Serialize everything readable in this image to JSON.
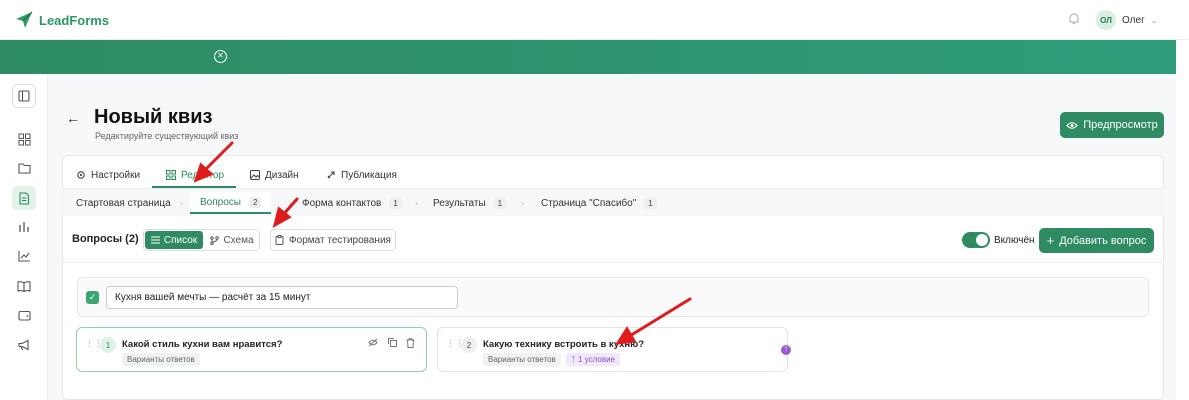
{
  "app": {
    "logo_text": "LeadForms",
    "brand_color": "#2e8b62"
  },
  "user": {
    "initials": "ОЛ",
    "name": "Олег"
  },
  "banner": {
    "close_icon": "close-circle-icon"
  },
  "sidebar": {
    "items": [
      {
        "icon": "sidebar-toggle-icon",
        "active": false
      },
      {
        "icon": "dashboard-grid-icon",
        "active": false
      },
      {
        "icon": "folder-icon",
        "active": false
      },
      {
        "icon": "document-icon",
        "active": true
      },
      {
        "icon": "bar-chart-icon",
        "active": false
      },
      {
        "icon": "line-chart-icon",
        "active": false
      },
      {
        "icon": "book-icon",
        "active": false
      },
      {
        "icon": "wallet-icon",
        "active": false
      },
      {
        "icon": "megaphone-icon",
        "active": false
      }
    ]
  },
  "page": {
    "title": "Новый квиз",
    "subtitle": "Редактируйте существующий квиз",
    "preview_label": "Предпросмотр"
  },
  "tabs": [
    {
      "label": "Настройки",
      "icon": "gear-icon"
    },
    {
      "label": "Редактор",
      "icon": "grid-icon",
      "active": true
    },
    {
      "label": "Дизайн",
      "icon": "image-icon"
    },
    {
      "label": "Публикация",
      "icon": "rocket-icon"
    }
  ],
  "subtabs": [
    {
      "label": "Стартовая страница"
    },
    {
      "label": "Вопросы",
      "count": "2",
      "active": true
    },
    {
      "label": "Форма контактов",
      "count": "1"
    },
    {
      "label": "Результаты",
      "count": "1"
    },
    {
      "label": "Страница \"Спасибо\"",
      "count": "1"
    }
  ],
  "toolbar": {
    "heading": "Вопросы (2)",
    "list_label": "Список",
    "scheme_label": "Схема",
    "format_label": "Формат тестирования",
    "enabled_label": "Включён",
    "enabled": true,
    "add_label": "Добавить вопрос"
  },
  "quiz_title": {
    "checked": true,
    "value": "Кухня вашей мечты — расчёт за 15 минут"
  },
  "questions": [
    {
      "number": "1",
      "title": "Какой стиль кухни вам нравится?",
      "type": "Варианты ответов",
      "selected": true
    },
    {
      "number": "2",
      "title": "Какую технику встроить в кухню?",
      "type": "Варианты ответов",
      "condition": "1 условие",
      "selected": false
    }
  ]
}
